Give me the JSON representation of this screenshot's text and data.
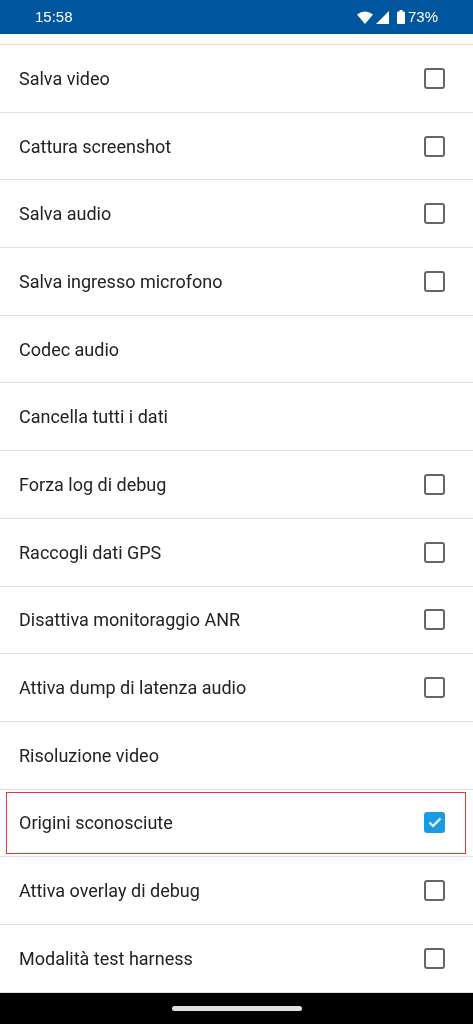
{
  "status_bar": {
    "time": "15:58",
    "battery": "73%"
  },
  "rows": [
    {
      "label": "Salva video",
      "kind": "checkbox",
      "checked": false,
      "highlighted": false
    },
    {
      "label": "Cattura screenshot",
      "kind": "checkbox",
      "checked": false,
      "highlighted": false
    },
    {
      "label": "Salva audio",
      "kind": "checkbox",
      "checked": false,
      "highlighted": false
    },
    {
      "label": "Salva ingresso microfono",
      "kind": "checkbox",
      "checked": false,
      "highlighted": false
    },
    {
      "label": "Codec audio",
      "kind": "action",
      "highlighted": false
    },
    {
      "label": "Cancella tutti i dati",
      "kind": "action",
      "highlighted": false
    },
    {
      "label": "Forza log di debug",
      "kind": "checkbox",
      "checked": false,
      "highlighted": false
    },
    {
      "label": "Raccogli dati GPS",
      "kind": "checkbox",
      "checked": false,
      "highlighted": false
    },
    {
      "label": "Disattiva monitoraggio ANR",
      "kind": "checkbox",
      "checked": false,
      "highlighted": false
    },
    {
      "label": "Attiva dump di latenza audio",
      "kind": "checkbox",
      "checked": false,
      "highlighted": false
    },
    {
      "label": "Risoluzione video",
      "kind": "action",
      "highlighted": false
    },
    {
      "label": "Origini sconosciute",
      "kind": "checkbox",
      "checked": true,
      "highlighted": true
    },
    {
      "label": "Attiva overlay di debug",
      "kind": "checkbox",
      "checked": false,
      "highlighted": false
    },
    {
      "label": "Modalità test harness",
      "kind": "checkbox",
      "checked": false,
      "highlighted": false
    }
  ]
}
